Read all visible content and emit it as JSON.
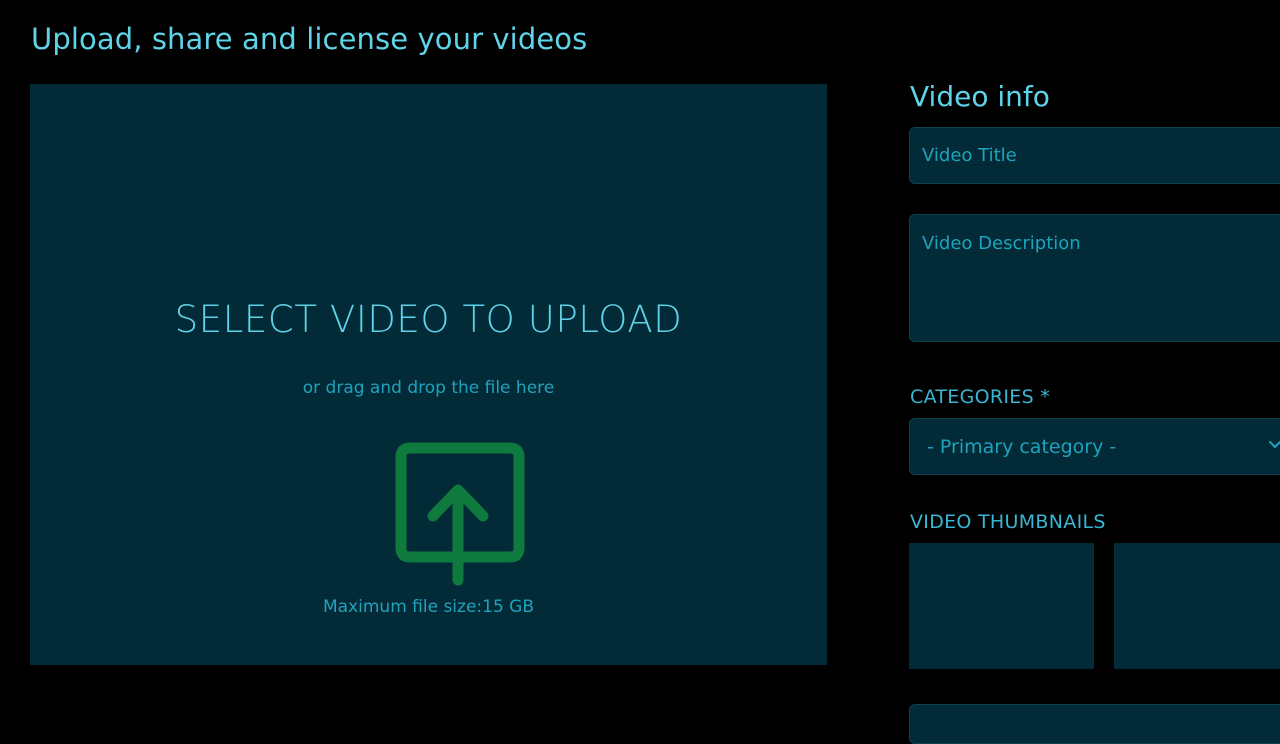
{
  "page": {
    "title": "Upload, share and license your videos"
  },
  "upload": {
    "heading": "SELECT VIDEO TO UPLOAD",
    "subtext": "or drag and drop the file here",
    "icon": "upload-icon",
    "max_size_text": "Maximum file size:15 GB"
  },
  "video_info": {
    "heading": "Video info",
    "title_placeholder": "Video Title",
    "title_value": "",
    "description_placeholder": "Video Description",
    "description_value": ""
  },
  "categories": {
    "label": "CATEGORIES *",
    "selected": "- Primary category -"
  },
  "thumbnails": {
    "label": "VIDEO THUMBNAILS"
  },
  "colors": {
    "background": "#000000",
    "panel": "#022a37",
    "accent_text": "#5fd3e8",
    "muted_text": "#1fa3bd",
    "upload_icon": "#0f7a3d"
  }
}
